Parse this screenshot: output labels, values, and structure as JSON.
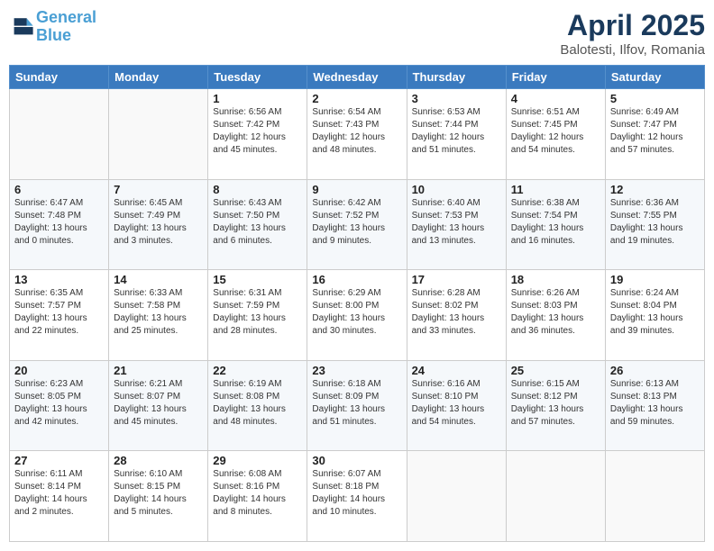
{
  "logo": {
    "line1": "General",
    "line2": "Blue"
  },
  "title": "April 2025",
  "subtitle": "Balotesti, Ilfov, Romania",
  "headers": [
    "Sunday",
    "Monday",
    "Tuesday",
    "Wednesday",
    "Thursday",
    "Friday",
    "Saturday"
  ],
  "weeks": [
    [
      {
        "day": "",
        "sunrise": "",
        "sunset": "",
        "daylight": ""
      },
      {
        "day": "",
        "sunrise": "",
        "sunset": "",
        "daylight": ""
      },
      {
        "day": "1",
        "sunrise": "Sunrise: 6:56 AM",
        "sunset": "Sunset: 7:42 PM",
        "daylight": "Daylight: 12 hours and 45 minutes."
      },
      {
        "day": "2",
        "sunrise": "Sunrise: 6:54 AM",
        "sunset": "Sunset: 7:43 PM",
        "daylight": "Daylight: 12 hours and 48 minutes."
      },
      {
        "day": "3",
        "sunrise": "Sunrise: 6:53 AM",
        "sunset": "Sunset: 7:44 PM",
        "daylight": "Daylight: 12 hours and 51 minutes."
      },
      {
        "day": "4",
        "sunrise": "Sunrise: 6:51 AM",
        "sunset": "Sunset: 7:45 PM",
        "daylight": "Daylight: 12 hours and 54 minutes."
      },
      {
        "day": "5",
        "sunrise": "Sunrise: 6:49 AM",
        "sunset": "Sunset: 7:47 PM",
        "daylight": "Daylight: 12 hours and 57 minutes."
      }
    ],
    [
      {
        "day": "6",
        "sunrise": "Sunrise: 6:47 AM",
        "sunset": "Sunset: 7:48 PM",
        "daylight": "Daylight: 13 hours and 0 minutes."
      },
      {
        "day": "7",
        "sunrise": "Sunrise: 6:45 AM",
        "sunset": "Sunset: 7:49 PM",
        "daylight": "Daylight: 13 hours and 3 minutes."
      },
      {
        "day": "8",
        "sunrise": "Sunrise: 6:43 AM",
        "sunset": "Sunset: 7:50 PM",
        "daylight": "Daylight: 13 hours and 6 minutes."
      },
      {
        "day": "9",
        "sunrise": "Sunrise: 6:42 AM",
        "sunset": "Sunset: 7:52 PM",
        "daylight": "Daylight: 13 hours and 9 minutes."
      },
      {
        "day": "10",
        "sunrise": "Sunrise: 6:40 AM",
        "sunset": "Sunset: 7:53 PM",
        "daylight": "Daylight: 13 hours and 13 minutes."
      },
      {
        "day": "11",
        "sunrise": "Sunrise: 6:38 AM",
        "sunset": "Sunset: 7:54 PM",
        "daylight": "Daylight: 13 hours and 16 minutes."
      },
      {
        "day": "12",
        "sunrise": "Sunrise: 6:36 AM",
        "sunset": "Sunset: 7:55 PM",
        "daylight": "Daylight: 13 hours and 19 minutes."
      }
    ],
    [
      {
        "day": "13",
        "sunrise": "Sunrise: 6:35 AM",
        "sunset": "Sunset: 7:57 PM",
        "daylight": "Daylight: 13 hours and 22 minutes."
      },
      {
        "day": "14",
        "sunrise": "Sunrise: 6:33 AM",
        "sunset": "Sunset: 7:58 PM",
        "daylight": "Daylight: 13 hours and 25 minutes."
      },
      {
        "day": "15",
        "sunrise": "Sunrise: 6:31 AM",
        "sunset": "Sunset: 7:59 PM",
        "daylight": "Daylight: 13 hours and 28 minutes."
      },
      {
        "day": "16",
        "sunrise": "Sunrise: 6:29 AM",
        "sunset": "Sunset: 8:00 PM",
        "daylight": "Daylight: 13 hours and 30 minutes."
      },
      {
        "day": "17",
        "sunrise": "Sunrise: 6:28 AM",
        "sunset": "Sunset: 8:02 PM",
        "daylight": "Daylight: 13 hours and 33 minutes."
      },
      {
        "day": "18",
        "sunrise": "Sunrise: 6:26 AM",
        "sunset": "Sunset: 8:03 PM",
        "daylight": "Daylight: 13 hours and 36 minutes."
      },
      {
        "day": "19",
        "sunrise": "Sunrise: 6:24 AM",
        "sunset": "Sunset: 8:04 PM",
        "daylight": "Daylight: 13 hours and 39 minutes."
      }
    ],
    [
      {
        "day": "20",
        "sunrise": "Sunrise: 6:23 AM",
        "sunset": "Sunset: 8:05 PM",
        "daylight": "Daylight: 13 hours and 42 minutes."
      },
      {
        "day": "21",
        "sunrise": "Sunrise: 6:21 AM",
        "sunset": "Sunset: 8:07 PM",
        "daylight": "Daylight: 13 hours and 45 minutes."
      },
      {
        "day": "22",
        "sunrise": "Sunrise: 6:19 AM",
        "sunset": "Sunset: 8:08 PM",
        "daylight": "Daylight: 13 hours and 48 minutes."
      },
      {
        "day": "23",
        "sunrise": "Sunrise: 6:18 AM",
        "sunset": "Sunset: 8:09 PM",
        "daylight": "Daylight: 13 hours and 51 minutes."
      },
      {
        "day": "24",
        "sunrise": "Sunrise: 6:16 AM",
        "sunset": "Sunset: 8:10 PM",
        "daylight": "Daylight: 13 hours and 54 minutes."
      },
      {
        "day": "25",
        "sunrise": "Sunrise: 6:15 AM",
        "sunset": "Sunset: 8:12 PM",
        "daylight": "Daylight: 13 hours and 57 minutes."
      },
      {
        "day": "26",
        "sunrise": "Sunrise: 6:13 AM",
        "sunset": "Sunset: 8:13 PM",
        "daylight": "Daylight: 13 hours and 59 minutes."
      }
    ],
    [
      {
        "day": "27",
        "sunrise": "Sunrise: 6:11 AM",
        "sunset": "Sunset: 8:14 PM",
        "daylight": "Daylight: 14 hours and 2 minutes."
      },
      {
        "day": "28",
        "sunrise": "Sunrise: 6:10 AM",
        "sunset": "Sunset: 8:15 PM",
        "daylight": "Daylight: 14 hours and 5 minutes."
      },
      {
        "day": "29",
        "sunrise": "Sunrise: 6:08 AM",
        "sunset": "Sunset: 8:16 PM",
        "daylight": "Daylight: 14 hours and 8 minutes."
      },
      {
        "day": "30",
        "sunrise": "Sunrise: 6:07 AM",
        "sunset": "Sunset: 8:18 PM",
        "daylight": "Daylight: 14 hours and 10 minutes."
      },
      {
        "day": "",
        "sunrise": "",
        "sunset": "",
        "daylight": ""
      },
      {
        "day": "",
        "sunrise": "",
        "sunset": "",
        "daylight": ""
      },
      {
        "day": "",
        "sunrise": "",
        "sunset": "",
        "daylight": ""
      }
    ]
  ]
}
